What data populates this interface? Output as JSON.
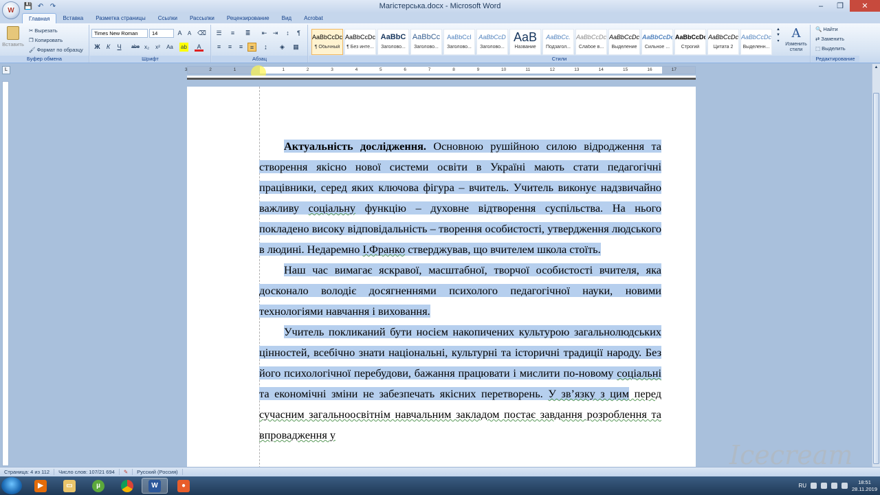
{
  "title_bar": {
    "title": "Магістерська.docx - Microsoft Word",
    "minimize": "‒",
    "maximize": "❐",
    "close": "✕"
  },
  "quick_access": [
    "save-icon",
    "undo-icon",
    "redo-icon"
  ],
  "tabs": [
    "Главная",
    "Вставка",
    "Разметка страницы",
    "Ссылки",
    "Рассылки",
    "Рецензирование",
    "Вид",
    "Acrobat"
  ],
  "active_tab": "Главная",
  "clipboard": {
    "paste": "Вставить",
    "cut": "Вырезать",
    "copy": "Копировать",
    "format_painter": "Формат по образцу",
    "label": "Буфер обмена"
  },
  "font": {
    "name": "Times New Roman",
    "size": "14",
    "label": "Шрифт",
    "bold": "Ж",
    "italic": "К",
    "underline": "Ч",
    "strike": "abe",
    "subscript": "x₂",
    "superscript": "x²",
    "case": "Aa"
  },
  "paragraph": {
    "label": "Абзац"
  },
  "styles": {
    "label": "Стили",
    "items": [
      {
        "sample": "AaBbCcDc",
        "name": "¶ Обычный"
      },
      {
        "sample": "AaBbCcDc",
        "name": "¶ Без инте..."
      },
      {
        "sample": "AaBbC",
        "name": "Заголово..."
      },
      {
        "sample": "AaBbCc",
        "name": "Заголово..."
      },
      {
        "sample": "AaBbCcI",
        "name": "Заголово..."
      },
      {
        "sample": "AaBbCcD",
        "name": "Заголово..."
      },
      {
        "sample": "AaB",
        "name": "Название"
      },
      {
        "sample": "AaBbCc.",
        "name": "Подзагол..."
      },
      {
        "sample": "AaBbCcDc",
        "name": "Слабое в..."
      },
      {
        "sample": "AaBbCcDc",
        "name": "Выделение"
      },
      {
        "sample": "AaBbCcDc",
        "name": "Сильное ..."
      },
      {
        "sample": "AaBbCcDc",
        "name": "Строгий"
      },
      {
        "sample": "AaBbCcDc",
        "name": "Цитата 2"
      },
      {
        "sample": "AaBbCcDc",
        "name": "Выделенн..."
      }
    ],
    "change_styles": "Изменить стили"
  },
  "editing": {
    "label": "Редактирование",
    "find": "Найти",
    "replace": "Заменить",
    "select": "Выделить"
  },
  "ruler": {
    "numbers": [
      "3",
      "2",
      "1",
      "1",
      "2",
      "3",
      "4",
      "5",
      "6",
      "7",
      "8",
      "9",
      "10",
      "11",
      "12",
      "13",
      "14",
      "15",
      "16",
      "17"
    ]
  },
  "document": {
    "p1_bold": "Актуальність дослідження.",
    "p1_a": " Основною рушійною силою відродження та створення якісно нової системи освіти в Україні мають стати педагогічні працівники, серед яких ключова фігура – вчитель. Учитель виконує надзвичайно важливу ",
    "p1_wavy1": "соціальну",
    "p1_b": " функцію – духовне відтворення суспільства. На нього покладено високу відповідальність – творення особистості, утвердження людського в людині. Недаремно ",
    "p1_wavy2": "І.Франко",
    "p1_c": " стверджував, що вчителем школа стоїть.",
    "p2": "Наш час вимагає яскравої, масштабної, творчої особистості вчителя, яка досконало володіє досягненнями психолого педагогічної науки, новими технологіями навчання і виховання.",
    "p3_a": "Учитель покликаний бути носієм накопичених культурою загальнолюдських цінностей, всебічно знати національні, культурні та історичні традиції народу. Без його психологічної перебудови, бажання працювати і мислити по-новому ",
    "p3_wavy": "соціальні",
    "p3_b": " та економічні зміни не забезпечать якісних перетворень. ",
    "p3_sel_wavy": "У зв’язку з цим",
    "p3_c": " перед сучасним загальноосвітнім навчальним закладом постає завдання розроблення та впровадження у"
  },
  "status": {
    "page": "Страница: 4 из 112",
    "words": "Число слов: 107/21 694",
    "language": "Русский (Россия)"
  },
  "taskbar": {
    "lang": "RU",
    "time": "18:51",
    "date": "28.11.2019",
    "apps": [
      "media-player",
      "file-explorer",
      "utorrent",
      "chrome",
      "word",
      "screen-recorder"
    ]
  },
  "watermark": "Icecream",
  "colors": {
    "selection": "#b6cfee",
    "ribbon_label": "#15428b",
    "highlight_yellow": "#ffff00",
    "font_red": "#e02020"
  }
}
